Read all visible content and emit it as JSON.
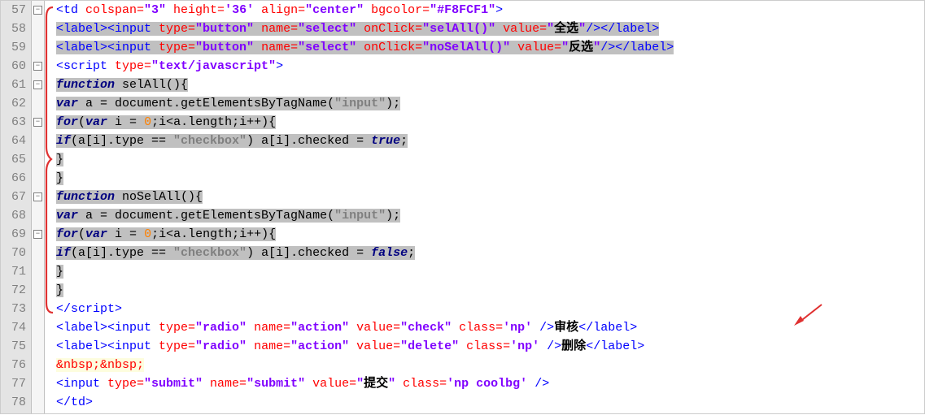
{
  "gutter": {
    "start": 57,
    "end": 78
  },
  "fold_symbol": "−",
  "code": {
    "l57": {
      "tag_open": "<td ",
      "attr1": "colspan=",
      "val1": "\"3\"",
      "attr2": " height=",
      "val2": "'36'",
      "attr3": " align=",
      "val3": "\"center\"",
      "attr4": " bgcolor=",
      "val4": "\"#F8FCF1\"",
      "tag_close": ">"
    },
    "l58": {
      "a": "<label><input ",
      "b": "type=",
      "c": "\"button\"",
      "d": " name=",
      "e": "\"select\"",
      "f": " onClick=",
      "g": "\"selAll()\"",
      "h": " value=",
      "i": "\"",
      "j": "全选",
      "k": "\"",
      "l": "/></label>"
    },
    "l59": {
      "a": "<label><input ",
      "b": "type=",
      "c": "\"button\"",
      "d": " name=",
      "e": "\"select\"",
      "f": " onClick=",
      "g": "\"noSelAll()\"",
      "h": " value=",
      "i": "\"",
      "j": "反选",
      "k": "\"",
      "l": "/></label>"
    },
    "l60": {
      "a": "<script ",
      "b": "type=",
      "c": "\"text/javascript\"",
      "d": ">"
    },
    "l61": {
      "a": "function",
      "b": " selAll(){"
    },
    "l62": {
      "a": "var",
      "b": " a = document.getElementsByTagName(",
      "c": "\"input\"",
      "d": ");"
    },
    "l63": {
      "a": "for",
      "b": "(",
      "c": "var",
      "d": " i = ",
      "e": "0",
      "f": ";i<a.length;i++){"
    },
    "l64": {
      "a": "if",
      "b": "(a[i].type == ",
      "c": "\"checkbox\"",
      "d": ") a[i].checked = ",
      "e": "true",
      "f": ";"
    },
    "l65": {
      "a": "}"
    },
    "l66": {
      "a": "}"
    },
    "l67": {
      "a": "function",
      "b": " noSelAll(){"
    },
    "l68": {
      "a": "var",
      "b": " a = document.getElementsByTagName(",
      "c": "\"input\"",
      "d": ");"
    },
    "l69": {
      "a": "for",
      "b": "(",
      "c": "var",
      "d": " i = ",
      "e": "0",
      "f": ";i<a.length;i++){"
    },
    "l70": {
      "a": "if",
      "b": "(a[i].type == ",
      "c": "\"checkbox\"",
      "d": ") a[i].checked = ",
      "e": "false",
      "f": ";"
    },
    "l71": {
      "a": "}"
    },
    "l72": {
      "a": "}"
    },
    "l73": {
      "a": "</script>"
    },
    "l74": {
      "a": "<label><input ",
      "b": "type=",
      "c": "\"radio\"",
      "d": " name=",
      "e": "\"action\"",
      "f": " value=",
      "g": "\"check\"",
      "h": " class=",
      "i": "'np'",
      "j": " />",
      "k": "审核",
      "l": "</label>"
    },
    "l75": {
      "a": "<label><input ",
      "b": "type=",
      "c": "\"radio\"",
      "d": " name=",
      "e": "\"action\"",
      "f": " value=",
      "g": "\"delete\"",
      "h": "  class=",
      "i": "'np'",
      "j": " />",
      "k": "删除",
      "l": "</label>"
    },
    "l76": {
      "a": "&nbsp;&nbsp;"
    },
    "l77": {
      "a": "<input ",
      "b": "type=",
      "c": "\"submit\"",
      "d": " name=",
      "e": "\"submit\"",
      "f": " value=",
      "g": "\"",
      "h": "提交",
      "i": "\"",
      "j": " class=",
      "k": "'np coolbg'",
      "l": " />"
    },
    "l78": {
      "a": "</td>"
    }
  }
}
